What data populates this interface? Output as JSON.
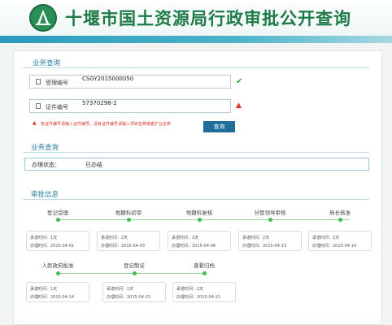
{
  "header": {
    "title": "十堰市国土资源局行政审批公开查询",
    "logo_icon": "bureau-emblem-icon"
  },
  "business_query": {
    "section_title": "业务查询",
    "acceptance_label": "受理编号",
    "acceptance_value": "CSGY2015000050",
    "cert_label": "证件编号",
    "cert_value": "57370298-2",
    "warning": "有证件编号请输入证件编号，没有证件编号请输入项目名称或者扩业名称",
    "query_button": "查询"
  },
  "status_section": {
    "section_title": "业务查询",
    "label": "办理状态：",
    "value": "已办结"
  },
  "approval": {
    "section_title": "审批信息",
    "steps_row1": [
      {
        "name": "登记受理",
        "time_label": "承诺时间：1天",
        "date_label": "办理时间：2015-04-01"
      },
      {
        "name": "地籍科初审",
        "time_label": "承诺时间：2天",
        "date_label": "办理时间：2015-04-03"
      },
      {
        "name": "地籍科复核",
        "time_label": "承诺时间：2天",
        "date_label": "办理时间：2015-04-08"
      },
      {
        "name": "分管领导审核",
        "time_label": "承诺时间：2天",
        "date_label": "办理时间：2015-04-13"
      },
      {
        "name": "局长核准",
        "time_label": "承诺时间：2天",
        "date_label": "办理时间：2015-04-14"
      }
    ],
    "steps_row2": [
      {
        "name": "人民政府批准",
        "time_label": "承诺时间：1天",
        "date_label": "办理时间：2015-04-14"
      },
      {
        "name": "登记制证",
        "time_label": "承诺时间：1天",
        "date_label": "办理时间：2015-04-15"
      },
      {
        "name": "查看归档",
        "time_label": "承诺时间：2天",
        "date_label": "办理时间：2015-04-15"
      }
    ]
  },
  "colors": {
    "accent": "#1e7a46",
    "link": "#2a7fa5",
    "button": "#1f6f9a",
    "ok": "#3fbf4f",
    "warn": "#d9302b"
  }
}
